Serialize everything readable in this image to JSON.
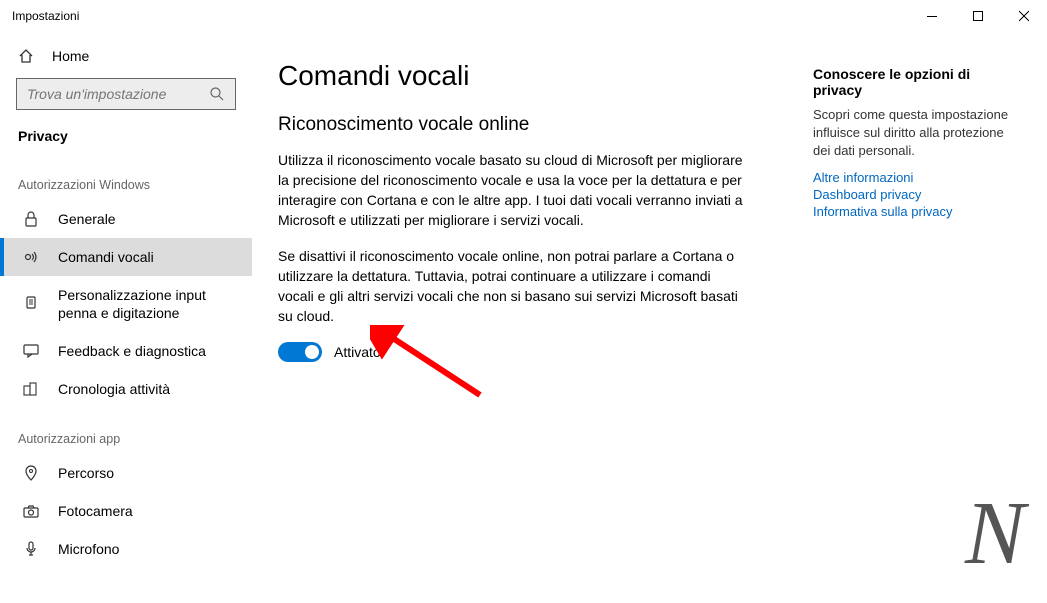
{
  "window": {
    "title": "Impostazioni"
  },
  "sidebar": {
    "home": "Home",
    "search_placeholder": "Trova un'impostazione",
    "category": "Privacy",
    "section_windows": "Autorizzazioni Windows",
    "items_win": [
      "Generale",
      "Comandi vocali",
      "Personalizzazione input penna e digitazione",
      "Feedback e diagnostica",
      "Cronologia attività"
    ],
    "section_app": "Autorizzazioni app",
    "items_app": [
      "Percorso",
      "Fotocamera",
      "Microfono"
    ]
  },
  "main": {
    "title": "Comandi vocali",
    "subtitle": "Riconoscimento vocale online",
    "para1": "Utilizza il riconoscimento vocale basato su cloud di Microsoft per migliorare la precisione del riconoscimento vocale e usa la voce per la dettatura e per interagire con Cortana e con le altre app. I tuoi dati vocali verranno inviati a Microsoft e utilizzati per migliorare i servizi vocali.",
    "para2": "Se disattivi il riconoscimento vocale online, non potrai parlare a Cortana o utilizzare la dettatura. Tuttavia, potrai continuare a utilizzare i comandi vocali e gli altri servizi vocali che non si basano sui servizi Microsoft basati su cloud.",
    "toggle_label": "Attivato"
  },
  "sideinfo": {
    "heading": "Conoscere le opzioni di privacy",
    "desc": "Scopri come questa impostazione influisce sul diritto alla protezione dei dati personali.",
    "links": [
      "Altre informazioni",
      "Dashboard privacy",
      "Informativa sulla privacy"
    ]
  }
}
